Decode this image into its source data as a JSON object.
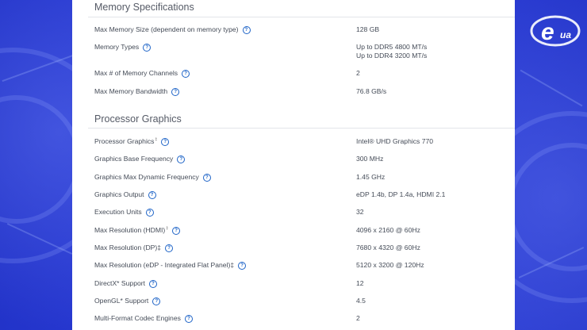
{
  "memory": {
    "title": "Memory Specifications",
    "rows": [
      {
        "label": "Max Memory Size (dependent on memory type)",
        "value": "128 GB"
      },
      {
        "label": "Memory Types",
        "value": "Up to DDR5 4800 MT/s",
        "value2": "Up to DDR4 3200 MT/s"
      },
      {
        "label": "Max # of Memory Channels",
        "value": "2"
      },
      {
        "label": "Max Memory Bandwidth",
        "value": "76.8 GB/s"
      }
    ]
  },
  "graphics": {
    "title": "Processor Graphics",
    "rows": [
      {
        "label": "Processor Graphics",
        "sup": "‡",
        "value": "Intel® UHD Graphics 770"
      },
      {
        "label": "Graphics Base Frequency",
        "value": "300 MHz"
      },
      {
        "label": "Graphics Max Dynamic Frequency",
        "value": "1.45 GHz"
      },
      {
        "label": "Graphics Output",
        "value": "eDP 1.4b, DP 1.4a, HDMI 2.1"
      },
      {
        "label": "Execution Units",
        "value": "32"
      },
      {
        "label": "Max Resolution (HDMI)",
        "sup": "‡",
        "value": "4096 x 2160 @ 60Hz"
      },
      {
        "label": "Max Resolution (DP)‡",
        "value": "7680 x 4320 @ 60Hz"
      },
      {
        "label": "Max Resolution (eDP - Integrated Flat Panel)‡",
        "value": "5120 x 3200 @ 120Hz"
      },
      {
        "label": "DirectX* Support",
        "value": "12"
      },
      {
        "label": "OpenGL* Support",
        "value": "4.5"
      },
      {
        "label": "Multi-Format Codec Engines",
        "value": "2"
      }
    ]
  },
  "help_icon_glyph": "?",
  "watermark": {
    "text": "e",
    "subtext": "ua"
  },
  "colors": {
    "background": "#2a39d8",
    "panel": "#ffffff",
    "link_blue": "#1d63c7",
    "text": "#444b57"
  }
}
